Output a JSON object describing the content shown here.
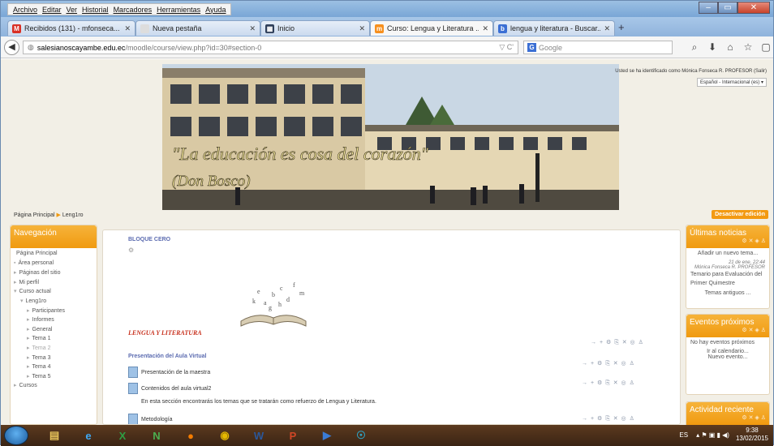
{
  "menu": [
    "Archivo",
    "Editar",
    "Ver",
    "Historial",
    "Marcadores",
    "Herramientas",
    "Ayuda"
  ],
  "window_controls": {
    "minimize": "–",
    "maximize": "▭",
    "close": "✕"
  },
  "tabs": [
    {
      "label": "Recibidos (131) - mfonseca...",
      "icon": "gmail-icon",
      "color": "#d93025",
      "glyph": "M",
      "active": false
    },
    {
      "label": "Nueva pestaña",
      "icon": "blank-tab-icon",
      "color": "#dddddd",
      "glyph": "",
      "active": false
    },
    {
      "label": "Inicio",
      "icon": "moodle-site-icon",
      "color": "#2f3f5a",
      "glyph": "▦",
      "active": false
    },
    {
      "label": "Curso: Lengua y Literatura ...",
      "icon": "moodle-icon",
      "color": "#f7901e",
      "glyph": "m",
      "active": true
    },
    {
      "label": "lengua y literatura - Buscar...",
      "icon": "bing-icon",
      "color": "#3b6fd4",
      "glyph": "b",
      "active": false
    }
  ],
  "tab_close": "✕",
  "new_tab": "+",
  "url": {
    "host": "salesianoscayambe.edu.ec",
    "path": "/moodle/course/view.php?id=30#section-0",
    "indicator": "▽ C'"
  },
  "search": {
    "engine": "G",
    "placeholder": "Google"
  },
  "nav_icons": [
    "⌕",
    "⬇",
    "⌂",
    "☆",
    "▢",
    "≡"
  ],
  "banner": {
    "motto": "\"La educación es cosa del corazón\"",
    "author": "(Don Bosco)"
  },
  "login_text": "Usted se ha identificado como Mónica Fonseca R. PROFESOR (Salir)",
  "language": "Español - Internacional (es)",
  "breadcrumb": {
    "home": "Página Principal",
    "sep": "▶",
    "course": "Leng1ro"
  },
  "edit_button": "Desactivar edición",
  "navigation": {
    "title": "Navegación",
    "items": [
      {
        "label": "Página Principal",
        "indent": 0,
        "prefix": ""
      },
      {
        "label": "Área personal",
        "indent": 0,
        "prefix": "▪"
      },
      {
        "label": "Páginas del sitio",
        "indent": 0,
        "prefix": "▸"
      },
      {
        "label": "Mi perfil",
        "indent": 0,
        "prefix": "▸"
      },
      {
        "label": "Curso actual",
        "indent": 0,
        "prefix": "▾"
      },
      {
        "label": "Leng1ro",
        "indent": 1,
        "prefix": "▾"
      },
      {
        "label": "Participantes",
        "indent": 2,
        "prefix": "▸"
      },
      {
        "label": "Informes",
        "indent": 2,
        "prefix": "▸"
      },
      {
        "label": "General",
        "indent": 2,
        "prefix": "▸"
      },
      {
        "label": "Tema 1",
        "indent": 2,
        "prefix": "▸"
      },
      {
        "label": "Tema 2",
        "indent": 2,
        "prefix": "▸",
        "dim": true
      },
      {
        "label": "Tema 3",
        "indent": 2,
        "prefix": "▸"
      },
      {
        "label": "Tema 4",
        "indent": 2,
        "prefix": "▸"
      },
      {
        "label": "Tema 5",
        "indent": 2,
        "prefix": "▸"
      },
      {
        "label": "Cursos",
        "indent": 0,
        "prefix": "▸"
      }
    ]
  },
  "main": {
    "section_title": "BLOQUE CERO",
    "heading": "LENGUA Y LITERATURA",
    "subheading": "Presentación del Aula Virtual",
    "activities": [
      "Presentación de la maestra",
      "Contenidos del aula virtual2"
    ],
    "summary": "En esta sección encontrarás los temas que se tratarán como refuerzo de Lengua y Literatura.",
    "last_item": "Metodología",
    "action_icons": "→ + ⚙ ⎘ ✕ ◎ ♙"
  },
  "news": {
    "title": "Últimas noticias",
    "add": "Añadir un nuevo tema...",
    "date": "21 de ene, 22:44",
    "author": "Mónica Fonseca R. PROFESOR",
    "item": "Temario para Evaluación del Primer Quimestre",
    "older": "Temas antiguos ..."
  },
  "events": {
    "title": "Eventos próximos",
    "none": "No hay eventos próximos",
    "calendar": "Ir al calendario...",
    "new": "Nuevo evento..."
  },
  "recent": {
    "title": "Actividad reciente"
  },
  "block_controls": "⚙ ✕ ◈ ♙",
  "taskbar": {
    "apps": [
      {
        "name": "explorer-icon",
        "glyph": "▤",
        "color": "#e7c35a"
      },
      {
        "name": "internet-explorer-icon",
        "glyph": "e",
        "color": "#3fa9f5"
      },
      {
        "name": "excel-icon",
        "glyph": "X",
        "color": "#2f9e44"
      },
      {
        "name": "pdf-app-icon",
        "glyph": "N",
        "color": "#4caf50"
      },
      {
        "name": "firefox-icon",
        "glyph": "●",
        "color": "#f57c00"
      },
      {
        "name": "chrome-icon",
        "glyph": "◉",
        "color": "#e6b800"
      },
      {
        "name": "word-icon",
        "glyph": "W",
        "color": "#2b579a"
      },
      {
        "name": "powerpoint-icon",
        "glyph": "P",
        "color": "#d24726"
      },
      {
        "name": "media-player-icon",
        "glyph": "▶",
        "color": "#3a7bd5"
      },
      {
        "name": "network-app-icon",
        "glyph": "☉",
        "color": "#2ca5c9"
      }
    ],
    "lang": "ES",
    "time": "9:38",
    "date": "13/02/2015"
  }
}
